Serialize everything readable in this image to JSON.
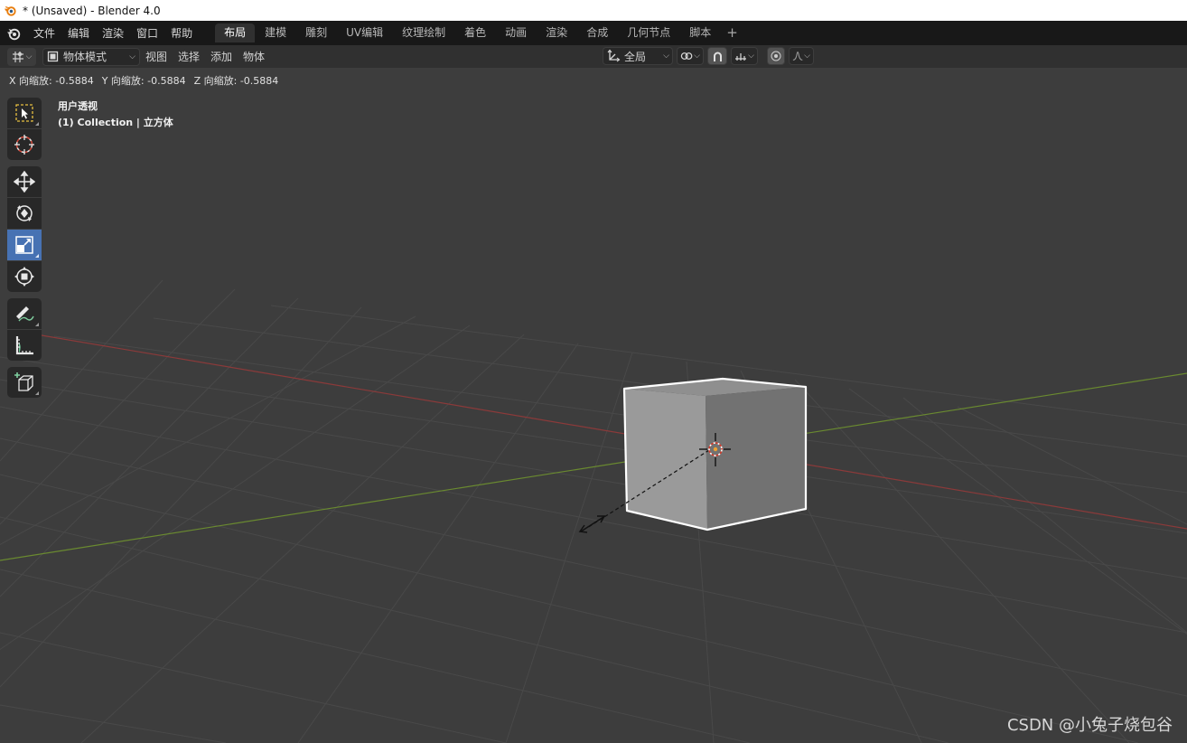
{
  "window": {
    "title": "* (Unsaved) - Blender 4.0"
  },
  "menubar": {
    "items": [
      "文件",
      "编辑",
      "渲染",
      "窗口",
      "帮助"
    ]
  },
  "workspaces": {
    "tabs": [
      "布局",
      "建模",
      "雕刻",
      "UV编辑",
      "纹理绘制",
      "着色",
      "动画",
      "渲染",
      "合成",
      "几何节点",
      "脚本"
    ],
    "active": "布局",
    "add_label": "+"
  },
  "viewport_header": {
    "mode": "物体模式",
    "menus": [
      "视图",
      "选择",
      "添加",
      "物体"
    ],
    "transform_orientation": "全局"
  },
  "operator_status": {
    "x": "X 向缩放: -0.5884",
    "y": "Y 向缩放: -0.5884",
    "z": "Z 向缩放: -0.5884"
  },
  "view_info": {
    "perspective": "用户透视",
    "collection": "(1) Collection | 立方体"
  },
  "toolbar": {
    "tools": [
      {
        "name": "select-box",
        "icon": "select-box-icon",
        "active": false
      },
      {
        "name": "cursor",
        "icon": "cursor-icon",
        "active": false
      },
      {
        "name": "move",
        "icon": "move-icon",
        "active": false
      },
      {
        "name": "rotate",
        "icon": "rotate-icon",
        "active": false
      },
      {
        "name": "scale",
        "icon": "scale-icon",
        "active": true
      },
      {
        "name": "transform",
        "icon": "transform-icon",
        "active": false
      },
      {
        "name": "annotate",
        "icon": "annotate-icon",
        "active": false
      },
      {
        "name": "measure",
        "icon": "measure-icon",
        "active": false
      },
      {
        "name": "add-cube",
        "icon": "add-cube-icon",
        "active": false
      }
    ]
  },
  "colors": {
    "viewport_bg": "#3d3d3d",
    "grid_line": "#494949",
    "x_axis": "#8b3a3a",
    "y_axis": "#6a8a30",
    "active_tool": "#4772b3",
    "selection_outline": "#ffffff"
  },
  "watermark": "CSDN @小兔子烧包谷"
}
